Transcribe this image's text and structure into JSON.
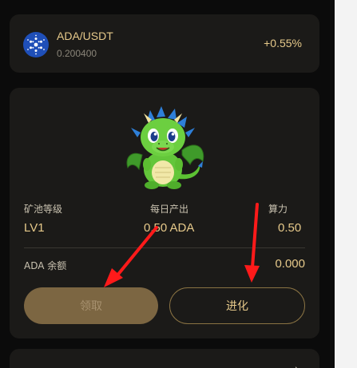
{
  "ticker": {
    "pair": "ADA/USDT",
    "price": "0.200400",
    "change": "+0.55%",
    "icon": "cardano-icon"
  },
  "pool": {
    "mascot": "green-dragon-mascot",
    "stats": [
      {
        "label": "矿池等级",
        "value": "LV1"
      },
      {
        "label": "每日产出",
        "value": "0.50 ADA"
      },
      {
        "label": "算力",
        "value": "0.50"
      }
    ],
    "balance_label": "ADA 余额",
    "balance_value": "0.000",
    "claim_label": "领取",
    "evolve_label": "进化"
  },
  "next_section": {
    "title": "",
    "arrow_icon": "chevron-right-icon"
  },
  "annotation": {
    "arrow_color": "#ff1a1a"
  }
}
